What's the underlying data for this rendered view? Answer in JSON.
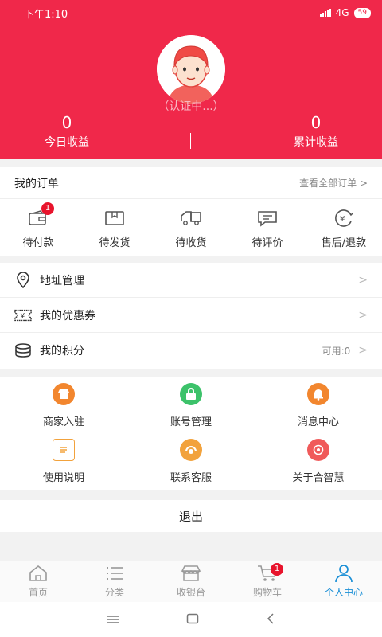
{
  "status_bar": {
    "time": "下午1:10",
    "network": "4G",
    "battery": "59"
  },
  "profile": {
    "cert_status": "（认证中...）"
  },
  "earnings": {
    "today_value": "0",
    "today_label": "今日收益",
    "total_value": "0",
    "total_label": "累计收益"
  },
  "orders": {
    "title": "我的订单",
    "view_all": "查看全部订单 >",
    "items": [
      {
        "label": "待付款",
        "icon": "wallet-icon",
        "badge": "1"
      },
      {
        "label": "待发货",
        "icon": "box-icon"
      },
      {
        "label": "待收货",
        "icon": "truck-icon"
      },
      {
        "label": "待评价",
        "icon": "comment-icon"
      },
      {
        "label": "售后/退款",
        "icon": "refund-icon"
      }
    ]
  },
  "menu": [
    {
      "label": "地址管理",
      "icon": "location-icon",
      "value": ""
    },
    {
      "label": "我的优惠券",
      "icon": "coupon-icon",
      "value": ""
    },
    {
      "label": "我的积分",
      "icon": "coins-icon",
      "value": "可用:0"
    }
  ],
  "grid": [
    {
      "label": "商家入驻",
      "icon": "shop-icon",
      "color": "#f2862e"
    },
    {
      "label": "账号管理",
      "icon": "lock-icon",
      "color": "#3cc26a"
    },
    {
      "label": "消息中心",
      "icon": "bell-icon",
      "color": "#f2862e"
    },
    {
      "label": "使用说明",
      "icon": "document-icon",
      "color": "#f2a23c"
    },
    {
      "label": "联系客服",
      "icon": "service-icon",
      "color": "#f2a23c"
    },
    {
      "label": "关于合智慧",
      "icon": "info-icon",
      "color": "#f05a5a"
    }
  ],
  "logout": "退出",
  "tabbar": {
    "items": [
      {
        "label": "首页",
        "icon": "home-icon"
      },
      {
        "label": "分类",
        "icon": "list-icon"
      },
      {
        "label": "收银台",
        "icon": "store-icon"
      },
      {
        "label": "购物车",
        "icon": "cart-icon",
        "badge": "1"
      },
      {
        "label": "个人中心",
        "icon": "person-icon",
        "active": true
      }
    ]
  },
  "colors": {
    "primary": "#f0284a",
    "tab_active": "#1a8fd6"
  }
}
